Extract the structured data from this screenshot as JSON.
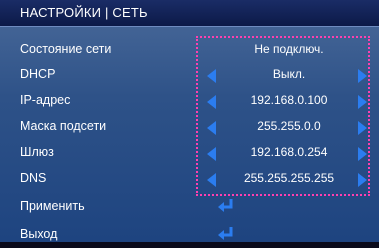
{
  "header": {
    "title": "НАСТРОЙКИ | СЕТЬ"
  },
  "rows": [
    {
      "label": "Состояние сети",
      "value": "Не подключ."
    },
    {
      "label": "DHCP",
      "value": "Выкл."
    },
    {
      "label": "IP-адрес",
      "value": "192.168.0.100"
    },
    {
      "label": "Маска подсети",
      "value": "255.255.0.0"
    },
    {
      "label": "Шлюз",
      "value": "192.168.0.254"
    },
    {
      "label": "DNS",
      "value": "255.255.255.255"
    },
    {
      "label": "Применить"
    },
    {
      "label": "Выход"
    }
  ],
  "colors": {
    "arrow": "#2b7df0",
    "highlight": "#ff3fb0",
    "title_bar": "#0c1a48"
  },
  "icons": {
    "left": "arrow-left-icon",
    "right": "arrow-right-icon",
    "enter": "enter-icon"
  }
}
